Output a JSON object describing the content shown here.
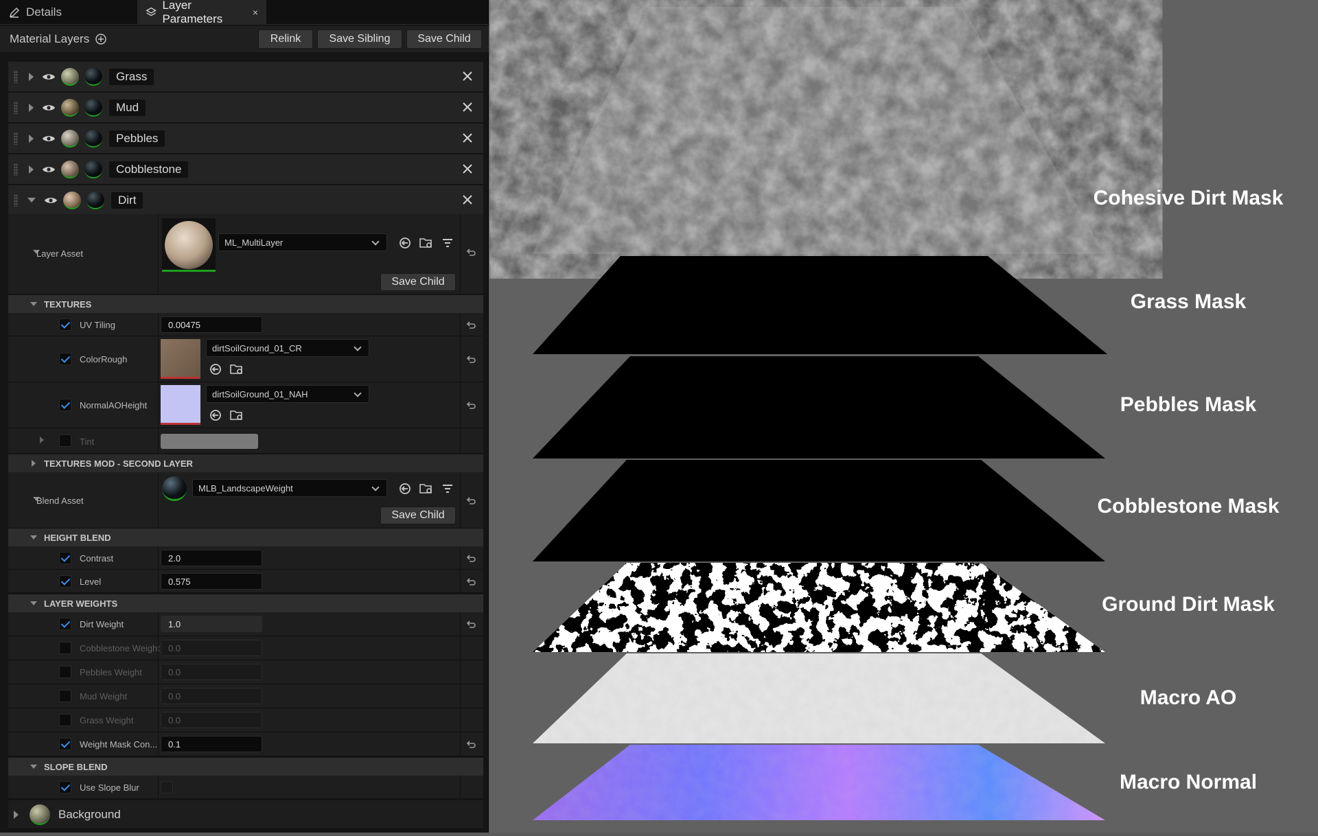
{
  "tabs": [
    {
      "label": "Details"
    },
    {
      "label": "Layer Parameters"
    }
  ],
  "toolbar": {
    "title": "Material Layers",
    "relink": "Relink",
    "save_sibling": "Save Sibling",
    "save_child": "Save Child"
  },
  "layers": [
    {
      "name": "Grass"
    },
    {
      "name": "Mud"
    },
    {
      "name": "Pebbles"
    },
    {
      "name": "Cobblestone"
    },
    {
      "name": "Dirt"
    }
  ],
  "layer_asset": {
    "label": "Layer Asset",
    "value": "ML_MultiLayer",
    "save_child": "Save Child"
  },
  "sections": {
    "textures": "TEXTURES",
    "textures_mod": "TEXTURES MOD - SECOND LAYER",
    "height_blend": "HEIGHT BLEND",
    "layer_weights": "LAYER WEIGHTS",
    "slope_blend": "SLOPE BLEND"
  },
  "textures": {
    "uv_tiling": {
      "label": "UV Tiling",
      "value": "0.00475"
    },
    "color_rough": {
      "label": "ColorRough",
      "value": "dirtSoilGround_01_CR"
    },
    "normal_ao": {
      "label": "NormalAOHeight",
      "value": "dirtSoilGround_01_NAH"
    },
    "tint": {
      "label": "Tint"
    }
  },
  "blend_asset": {
    "label": "Blend Asset",
    "value": "MLB_LandscapeWeight",
    "save_child": "Save Child"
  },
  "height_blend": {
    "contrast": {
      "label": "Contrast",
      "value": "2.0"
    },
    "level": {
      "label": "Level",
      "value": "0.575"
    }
  },
  "weights": [
    {
      "label": "Dirt Weight",
      "value": "1.0",
      "on": true
    },
    {
      "label": "Cobblestone Weight",
      "value": "0.0",
      "on": false
    },
    {
      "label": "Pebbles Weight",
      "value": "0.0",
      "on": false
    },
    {
      "label": "Mud Weight",
      "value": "0.0",
      "on": false
    },
    {
      "label": "Grass Weight",
      "value": "0.0",
      "on": false
    },
    {
      "label": "Weight Mask Con...",
      "value": "0.1",
      "on": true
    }
  ],
  "slope": {
    "label": "Use Slope Blur"
  },
  "background": {
    "label": "Background"
  },
  "overlays": [
    "Cohesive Dirt Mask",
    "Grass Mask",
    "Pebbles Mask",
    "Cobblestone Mask",
    "Ground Dirt Mask",
    "Macro AO",
    "Macro Normal"
  ],
  "colors": {
    "accent": "#3d8cf0",
    "green": "#1ea01e"
  }
}
